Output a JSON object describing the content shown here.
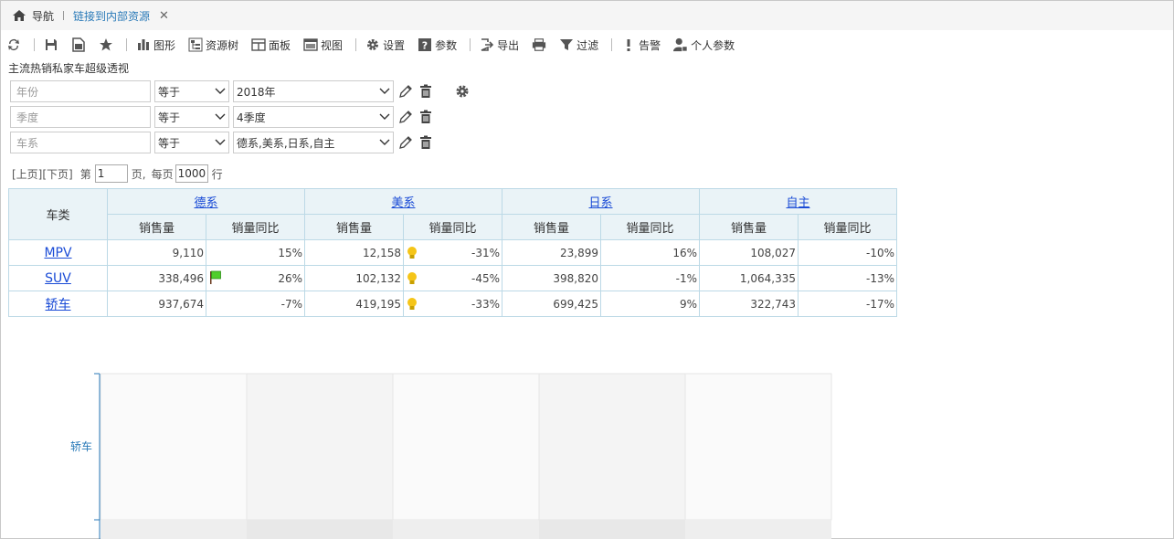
{
  "tabs": {
    "home": "导航",
    "active": "链接到内部资源"
  },
  "toolbar": {
    "chart": "图形",
    "resource_tree": "资源树",
    "panel": "面板",
    "view": "视图",
    "settings": "设置",
    "params": "参数",
    "export": "导出",
    "filter": "过滤",
    "alert": "告警",
    "personal_params": "个人参数"
  },
  "report_title": "主流热销私家车超级透视",
  "filters": [
    {
      "field": "年份",
      "op": "等于",
      "value": "2018年"
    },
    {
      "field": "季度",
      "op": "等于",
      "value": "4季度"
    },
    {
      "field": "车系",
      "op": "等于",
      "value": "德系,美系,日系,自主"
    }
  ],
  "pager": {
    "prev_next": "[上页][下页]",
    "page_label": "第",
    "page": "1",
    "page_suffix": "页,",
    "per_page_label": "每页",
    "per_page": "1000",
    "row_suffix": "行"
  },
  "table": {
    "row_header": "车类",
    "groups": [
      "德系",
      "美系",
      "日系",
      "自主"
    ],
    "sub_headers": [
      "销售量",
      "销量同比"
    ],
    "rows": [
      {
        "category": "MPV",
        "cells": [
          "9,110",
          "15%",
          "12,158",
          "-31%",
          "23,899",
          "16%",
          "108,027",
          "-10%"
        ]
      },
      {
        "category": "SUV",
        "cells": [
          "338,496",
          "26%",
          "102,132",
          "-45%",
          "398,820",
          "-1%",
          "1,064,335",
          "-13%"
        ]
      },
      {
        "category": "轿车",
        "cells": [
          "937,674",
          "-7%",
          "419,195",
          "-33%",
          "699,425",
          "9%",
          "322,743",
          "-17%"
        ]
      }
    ]
  },
  "chart_data": {
    "type": "bar",
    "categories": [
      "轿车"
    ],
    "ylabel": ""
  },
  "colors": {
    "link": "#1a4bd6",
    "header_bg": "#eaf3f7",
    "border": "#bcd9e6",
    "axis": "#2a7ab8"
  }
}
